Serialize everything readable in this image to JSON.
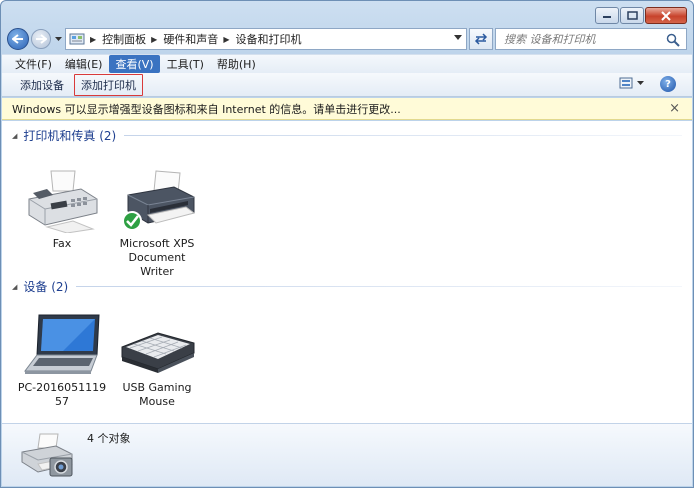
{
  "window": {
    "caption_buttons": [
      "minimize-icon",
      "maximize-icon",
      "close-icon"
    ]
  },
  "address_bar": {
    "location_icon": "control-panel-icon",
    "breadcrumbs": [
      "控制面板",
      "硬件和声音",
      "设备和打印机"
    ]
  },
  "search": {
    "placeholder": "搜索 设备和打印机"
  },
  "menu": {
    "items": [
      "文件(F)",
      "编辑(E)",
      "查看(V)",
      "工具(T)",
      "帮助(H)"
    ],
    "active_index": 2
  },
  "toolbar": {
    "add_device": "添加设备",
    "add_printer": "添加打印机",
    "help": "?"
  },
  "infobar": {
    "text": "Windows 可以显示增强型设备图标和来自 Internet 的信息。请单击进行更改...",
    "close": "×"
  },
  "groups": [
    {
      "title": "打印机和传真 (2)",
      "items": [
        {
          "label": "Fax",
          "icon": "fax-machine-icon"
        },
        {
          "label": "Microsoft XPS Document Writer",
          "icon": "printer-icon",
          "default": true
        }
      ]
    },
    {
      "title": "设备 (2)",
      "items": [
        {
          "label": "PC-2016051119 57",
          "icon": "laptop-icon"
        },
        {
          "label": "USB Gaming Mouse",
          "icon": "keyboard-icon"
        }
      ]
    }
  ],
  "status": {
    "count_text": "4 个对象",
    "icon": "printer-camera-icon"
  },
  "colors": {
    "group_title": "#1e3f8f",
    "menu_active": "#3a73c1",
    "infobar_bg": "#fffbd8",
    "highlight_outline": "#d93a3a"
  }
}
